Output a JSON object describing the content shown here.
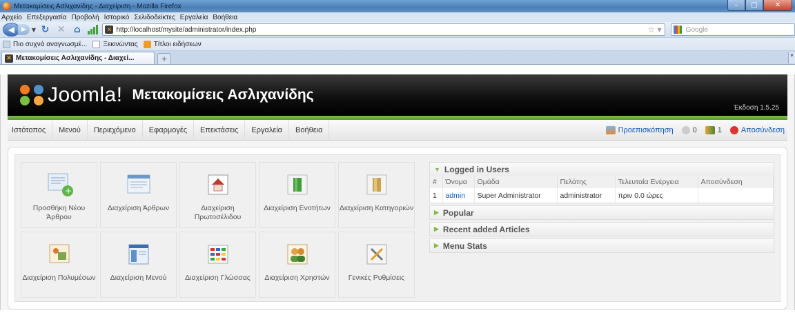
{
  "window": {
    "title": "Μετακομίσεις Ασλιχανίδης - Διαχείριση - Mozilla Firefox"
  },
  "menubar": [
    "Αρχείο",
    "Επεξεργασία",
    "Προβολή",
    "Ιστορικό",
    "Σελιδοδείκτες",
    "Εργαλεία",
    "Βοήθεια"
  ],
  "navbar": {
    "url": "http://localhost/mysite/administrator/index.php",
    "search_placeholder": "Google"
  },
  "bookmarks": [
    {
      "label": "Πιο συχνά αναγνωσμέ...",
      "icon": "page-icon"
    },
    {
      "label": "Ξεκινώντας",
      "icon": "page-icon"
    },
    {
      "label": "Τίτλοι ειδήσεων",
      "icon": "rss-icon"
    }
  ],
  "tabs": [
    {
      "label": "Μετακομίσεις Ασλιχανίδης - Διαχεί..."
    }
  ],
  "joomla": {
    "logo_text": "Joomla!",
    "site_name": "Μετακομίσεις Ασλιχανίδης",
    "version": "Έκδοση 1.5.25",
    "menu": [
      "Ιστότοπος",
      "Μενού",
      "Περιεχόμενο",
      "Εφαρμογές",
      "Επεκτάσεις",
      "Εργαλεία",
      "Βοήθεια"
    ],
    "status": {
      "preview": "Προεπισκόπηση",
      "messages": "0",
      "users_online": "1",
      "logout": "Αποσύνδεση"
    },
    "quickicons": [
      {
        "label": "Προσθήκη Νέου Άρθρου",
        "icon": "add-article-icon"
      },
      {
        "label": "Διαχείριση Άρθρων",
        "icon": "article-manager-icon"
      },
      {
        "label": "Διαχείριση Πρωτοσέλιδου",
        "icon": "frontpage-icon"
      },
      {
        "label": "Διαχείριση Ενοτήτων",
        "icon": "section-icon"
      },
      {
        "label": "Διαχείριση Κατηγοριών",
        "icon": "category-icon"
      },
      {
        "label": "Διαχείριση Πολυμέσων",
        "icon": "media-icon"
      },
      {
        "label": "Διαχείριση Μενού",
        "icon": "menu-icon"
      },
      {
        "label": "Διαχείριση Γλώσσας",
        "icon": "language-icon"
      },
      {
        "label": "Διαχείριση Χρηστών",
        "icon": "users-icon"
      },
      {
        "label": "Γενικές Ρυθμίσεις",
        "icon": "config-icon"
      }
    ],
    "logged_users": {
      "title": "Logged in Users",
      "headers": [
        "#",
        "Όνομα",
        "Ομάδα",
        "Πελάτης",
        "Τελευταία Ενέργεια",
        "Αποσύνδεση"
      ],
      "rows": [
        {
          "num": "1",
          "name": "admin",
          "group": "Super Administrator",
          "client": "administrator",
          "last": "πριν 0.0 ώρες",
          "logout": ""
        }
      ]
    },
    "panes": [
      "Popular",
      "Recent added Articles",
      "Menu Stats"
    ]
  }
}
